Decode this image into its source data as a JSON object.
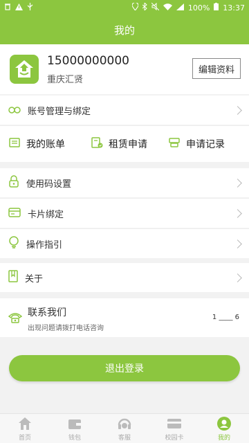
{
  "status_bar": {
    "battery": "100%",
    "time": "13:37"
  },
  "header": {
    "title": "我的"
  },
  "profile": {
    "phone": "15000000000",
    "org": "重庆汇贤",
    "edit_label": "编辑资料"
  },
  "account_row": {
    "label": "账号管理与绑定"
  },
  "quick_actions": [
    {
      "label": "我的账单",
      "icon": "bill-icon"
    },
    {
      "label": "租赁申请",
      "icon": "rent-apply-icon"
    },
    {
      "label": "申请记录",
      "icon": "apply-record-icon"
    }
  ],
  "settings_rows": [
    {
      "label": "使用码设置",
      "icon": "lock-icon"
    },
    {
      "label": "卡片绑定",
      "icon": "card-icon"
    },
    {
      "label": "操作指引",
      "icon": "bulb-icon"
    }
  ],
  "about_row": {
    "label": "关于",
    "icon": "bookmark-icon"
  },
  "contact": {
    "title": "联系我们",
    "subtitle": "出现问题请拨打电话咨询",
    "number": "1 ____ 6"
  },
  "logout_label": "退出登录",
  "tabs": [
    {
      "label": "首页",
      "icon": "home-icon",
      "active": false
    },
    {
      "label": "钱包",
      "icon": "wallet-icon",
      "active": false
    },
    {
      "label": "客服",
      "icon": "headset-icon",
      "active": false
    },
    {
      "label": "校园卡",
      "icon": "campus-card-icon",
      "active": false
    },
    {
      "label": "我的",
      "icon": "profile-icon",
      "active": true
    }
  ],
  "colors": {
    "accent": "#8cc63f"
  }
}
